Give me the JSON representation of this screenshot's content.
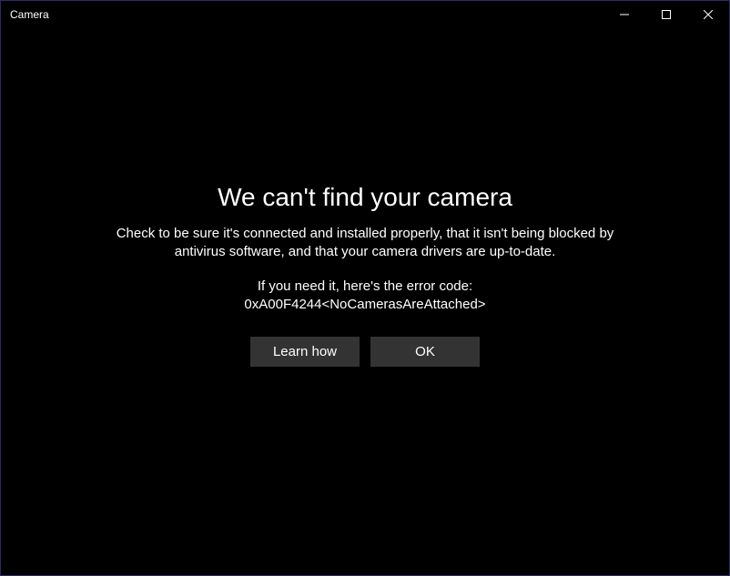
{
  "titlebar": {
    "title": "Camera"
  },
  "error": {
    "heading": "We can't find your camera",
    "description": "Check to be sure it's connected and installed properly, that it isn't being blocked by antivirus software, and that your camera drivers are up-to-date.",
    "code_intro": "If you need it, here's the error code:",
    "code": "0xA00F4244<NoCamerasAreAttached>",
    "learn_how_label": "Learn how",
    "ok_label": "OK"
  }
}
